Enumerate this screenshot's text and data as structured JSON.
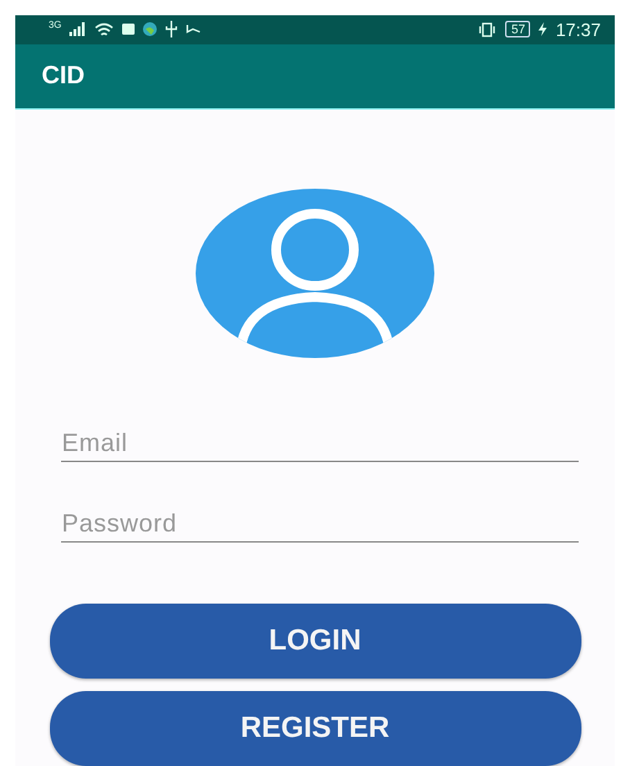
{
  "status_bar": {
    "network": "3G",
    "battery": "57",
    "time": "17:37"
  },
  "app_bar": {
    "title": "CID"
  },
  "form": {
    "fields": [
      {
        "placeholder": "Email"
      },
      {
        "placeholder": "Password"
      }
    ],
    "buttons": [
      "LOGIN",
      "REGISTER"
    ]
  }
}
